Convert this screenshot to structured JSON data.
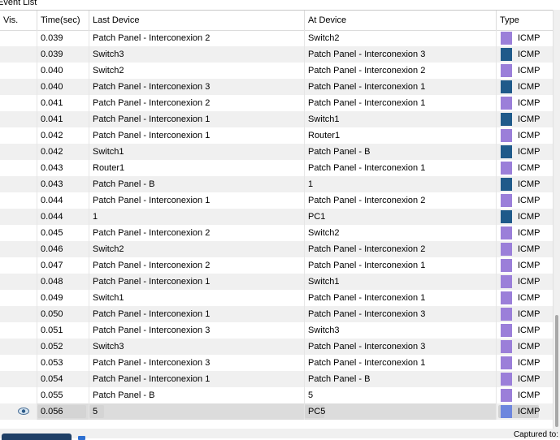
{
  "window": {
    "title": "Event List"
  },
  "columns": {
    "vis": "Vis.",
    "time": "Time(sec)",
    "last": "Last Device",
    "at": "At Device",
    "type": "Type"
  },
  "colors": {
    "icmp_light": "#9b7fd9",
    "icmp_dark": "#1f5a8a",
    "icmp_selected": "#6d86de",
    "selection": "#d4d4d4"
  },
  "rows": [
    {
      "time": "0.039",
      "last": "Patch Panel - Interconexion 2",
      "at": "Switch2",
      "type": "ICMP",
      "color": "light"
    },
    {
      "time": "0.039",
      "last": "Switch3",
      "at": "Patch Panel - Interconexion 3",
      "type": "ICMP",
      "color": "dark"
    },
    {
      "time": "0.040",
      "last": "Switch2",
      "at": "Patch Panel - Interconexion 2",
      "type": "ICMP",
      "color": "light"
    },
    {
      "time": "0.040",
      "last": "Patch Panel - Interconexion 3",
      "at": "Patch Panel - Interconexion 1",
      "type": "ICMP",
      "color": "dark"
    },
    {
      "time": "0.041",
      "last": "Patch Panel - Interconexion 2",
      "at": "Patch Panel - Interconexion 1",
      "type": "ICMP",
      "color": "light"
    },
    {
      "time": "0.041",
      "last": "Patch Panel - Interconexion 1",
      "at": "Switch1",
      "type": "ICMP",
      "color": "dark"
    },
    {
      "time": "0.042",
      "last": "Patch Panel - Interconexion 1",
      "at": "Router1",
      "type": "ICMP",
      "color": "light"
    },
    {
      "time": "0.042",
      "last": "Switch1",
      "at": "Patch Panel - B",
      "type": "ICMP",
      "color": "dark"
    },
    {
      "time": "0.043",
      "last": "Router1",
      "at": "Patch Panel - Interconexion 1",
      "type": "ICMP",
      "color": "light"
    },
    {
      "time": "0.043",
      "last": "Patch Panel - B",
      "at": "1",
      "type": "ICMP",
      "color": "dark"
    },
    {
      "time": "0.044",
      "last": "Patch Panel - Interconexion 1",
      "at": "Patch Panel - Interconexion 2",
      "type": "ICMP",
      "color": "light"
    },
    {
      "time": "0.044",
      "last": "1",
      "at": "PC1",
      "type": "ICMP",
      "color": "dark"
    },
    {
      "time": "0.045",
      "last": "Patch Panel - Interconexion 2",
      "at": "Switch2",
      "type": "ICMP",
      "color": "light"
    },
    {
      "time": "0.046",
      "last": "Switch2",
      "at": "Patch Panel - Interconexion 2",
      "type": "ICMP",
      "color": "light"
    },
    {
      "time": "0.047",
      "last": "Patch Panel - Interconexion 2",
      "at": "Patch Panel - Interconexion 1",
      "type": "ICMP",
      "color": "light"
    },
    {
      "time": "0.048",
      "last": "Patch Panel - Interconexion 1",
      "at": "Switch1",
      "type": "ICMP",
      "color": "light"
    },
    {
      "time": "0.049",
      "last": "Switch1",
      "at": "Patch Panel - Interconexion 1",
      "type": "ICMP",
      "color": "light"
    },
    {
      "time": "0.050",
      "last": "Patch Panel - Interconexion 1",
      "at": "Patch Panel - Interconexion 3",
      "type": "ICMP",
      "color": "light"
    },
    {
      "time": "0.051",
      "last": "Patch Panel - Interconexion 3",
      "at": "Switch3",
      "type": "ICMP",
      "color": "light"
    },
    {
      "time": "0.052",
      "last": "Switch3",
      "at": "Patch Panel - Interconexion 3",
      "type": "ICMP",
      "color": "light"
    },
    {
      "time": "0.053",
      "last": "Patch Panel - Interconexion 3",
      "at": "Patch Panel - Interconexion 1",
      "type": "ICMP",
      "color": "light"
    },
    {
      "time": "0.054",
      "last": "Patch Panel - Interconexion 1",
      "at": "Patch Panel - B",
      "type": "ICMP",
      "color": "light"
    },
    {
      "time": "0.055",
      "last": "Patch Panel - B",
      "at": "5",
      "type": "ICMP",
      "color": "light"
    },
    {
      "time": "0.056",
      "last": "5",
      "at": "PC5",
      "type": "ICMP",
      "color": "selected",
      "selected": true,
      "visible_icon": "eye-icon"
    }
  ],
  "footer": {
    "captured_label": "Captured to:"
  }
}
